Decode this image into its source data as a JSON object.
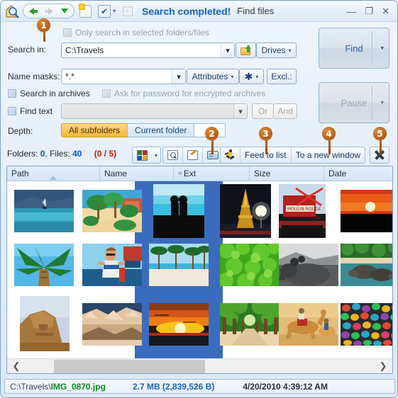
{
  "window": {
    "status_text": "Search completed!",
    "title": "Find files",
    "minimize": "—",
    "maximize": "❐",
    "close": "✕"
  },
  "titlebar_icons": {
    "app": "magnifier-house-icon",
    "back": "back-arrow-icon",
    "forward": "forward-arrow-icon",
    "history": "history-dropdown-icon",
    "newdoc": "new-document-icon",
    "checkbox_menu": "✔",
    "checkbox_caret": "▾",
    "small_caret": "▾",
    "panel_toggle": "▫"
  },
  "form": {
    "only_selected_label": "Only search in selected folders/files",
    "search_in_label": "Search in:",
    "search_in_underline": "S",
    "search_in_value": "C:\\Travels",
    "search_in_caret": "▾",
    "folder_button": "open-folder-icon",
    "drives_label": "Drives",
    "drives_caret": "▾",
    "name_masks_label": "Name masks:",
    "name_masks_value": "*.*",
    "name_masks_caret": "▾",
    "attributes_label": "Attributes",
    "attributes_caret": "▾",
    "asterisk_label": "✱",
    "asterisk_caret": "▾",
    "excl_label": "Excl.:",
    "search_archives_label": "Search in archives",
    "ask_password_label": "Ask for password for encrypted archives",
    "find_text_label": "Find text",
    "find_text_value": "",
    "find_text_caret": "▾",
    "or_label": "Or",
    "and_label": "And",
    "depth_label": "Depth:",
    "depth_all": "All subfolders",
    "depth_current": "Current folder",
    "depth_value": ""
  },
  "actions": {
    "find_label": "Find",
    "find_caret": "▾",
    "pause_label": "Pause",
    "pause_caret": "▾"
  },
  "results": {
    "folders_label": "Folders:",
    "folders_count": "0",
    "comma": ", ",
    "files_label": "Files:",
    "files_count": "40",
    "selection_count": "(0 / 5)",
    "view_icon": "thumbnail-view-icon",
    "view_caret": "▾",
    "preview_icon": "preview-icon",
    "edit_icon": "edit-icon",
    "info_icon": "info-card-icon",
    "runner_icon": "runner-icon",
    "feed_to_list_label": "Feed to list",
    "to_new_window_label": "To a new window",
    "close_results_icon": "close-results-icon"
  },
  "columns": [
    {
      "label": "Path",
      "sorted": true
    },
    {
      "label": "Name",
      "sorted": false
    },
    {
      "label": "Ext",
      "sorted": false,
      "prefix": "="
    },
    {
      "label": "Size",
      "sorted": false
    },
    {
      "label": "Date",
      "sorted": false
    }
  ],
  "scrollbar": {
    "left_arrow": "❮",
    "right_arrow": "❯"
  },
  "statusbar": {
    "path_prefix": "C:\\Travels\\",
    "file_name": "IMG_0870.jpg",
    "size": "2.7 MB (2,839,526 B)",
    "date": "4/20/2010 4:39:12 AM"
  },
  "pins": [
    {
      "number": "1"
    },
    {
      "number": "2"
    },
    {
      "number": "3"
    },
    {
      "number": "4"
    },
    {
      "number": "5"
    }
  ],
  "thumbnails": [
    {
      "name": "sea-windsurfer",
      "col": 0,
      "row": 0
    },
    {
      "name": "palm-beach-resort",
      "col": 1,
      "row": 0
    },
    {
      "name": "couple-silhouette",
      "col": 2,
      "row": 0
    },
    {
      "name": "eiffel-tower-night",
      "col": 3,
      "row": 0
    },
    {
      "name": "moulin-rouge",
      "col": 4,
      "row": 0
    },
    {
      "name": "orange-sunset-sea",
      "col": 5,
      "row": 0
    },
    {
      "name": "palm-tree-up",
      "col": 0,
      "row": 1
    },
    {
      "name": "boy-at-beach",
      "col": 1,
      "row": 1
    },
    {
      "name": "palm-beach-white",
      "col": 2,
      "row": 1
    },
    {
      "name": "green-foliage",
      "col": 3,
      "row": 1
    },
    {
      "name": "elephant-grayscale",
      "col": 4,
      "row": 1
    },
    {
      "name": "turtles-in-water",
      "col": 5,
      "row": 1
    },
    {
      "name": "sphinx-rock",
      "col": 0,
      "row": 2
    },
    {
      "name": "canyon-rock",
      "col": 1,
      "row": 2
    },
    {
      "name": "red-sunset-ocean",
      "col": 2,
      "row": 2
    },
    {
      "name": "tree-lined-path",
      "col": 3,
      "row": 2
    },
    {
      "name": "camel-riders",
      "col": 4,
      "row": 2
    },
    {
      "name": "colored-stones",
      "col": 5,
      "row": 2
    }
  ]
}
